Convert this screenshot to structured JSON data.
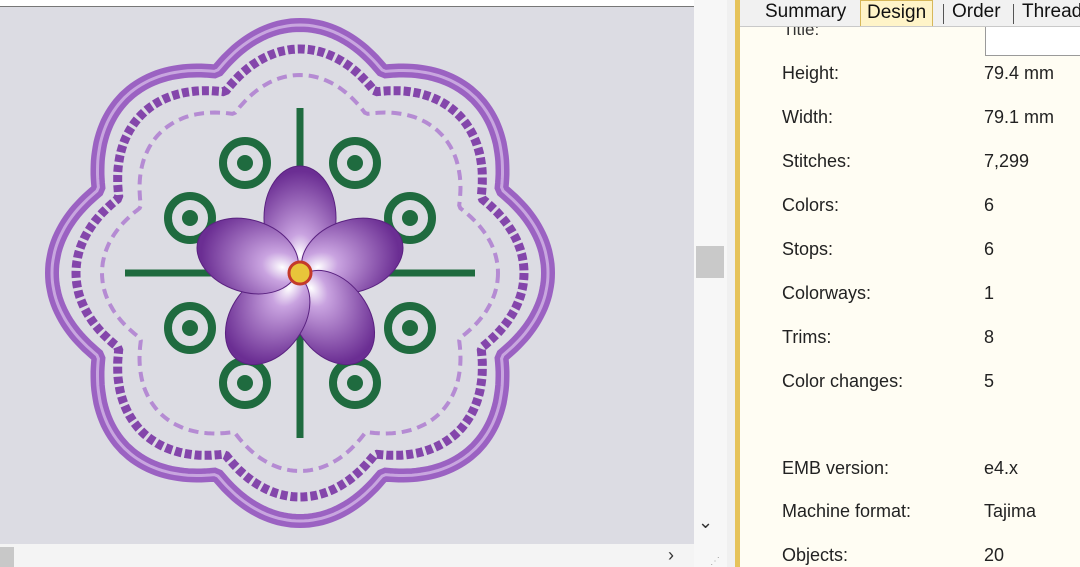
{
  "tabs": [
    "Summary",
    "Design",
    "Order",
    "Thread"
  ],
  "active_tab": "Design",
  "title_label": "Title:",
  "properties": [
    {
      "label": "Height:",
      "value": "79.4 mm"
    },
    {
      "label": "Width:",
      "value": "79.1 mm"
    },
    {
      "label": "Stitches:",
      "value": "7,299"
    },
    {
      "label": "Colors:",
      "value": "6"
    },
    {
      "label": "Stops:",
      "value": "6"
    },
    {
      "label": "Colorways:",
      "value": "1"
    },
    {
      "label": "Trims:",
      "value": "8"
    },
    {
      "label": "Color changes:",
      "value": "5"
    },
    {
      "label": "EMB version:",
      "value": "e4.x"
    },
    {
      "label": "Machine format:",
      "value": "Tajima"
    },
    {
      "label": "Objects:",
      "value": "20"
    }
  ],
  "colors": {
    "thread_purple": "#8b4fb0",
    "thread_green": "#1f6b3f",
    "panel_accent": "#e6c35a",
    "canvas_bg": "#dcdce3"
  },
  "icons": [
    "chevron-down-icon",
    "chevron-right-icon"
  ]
}
